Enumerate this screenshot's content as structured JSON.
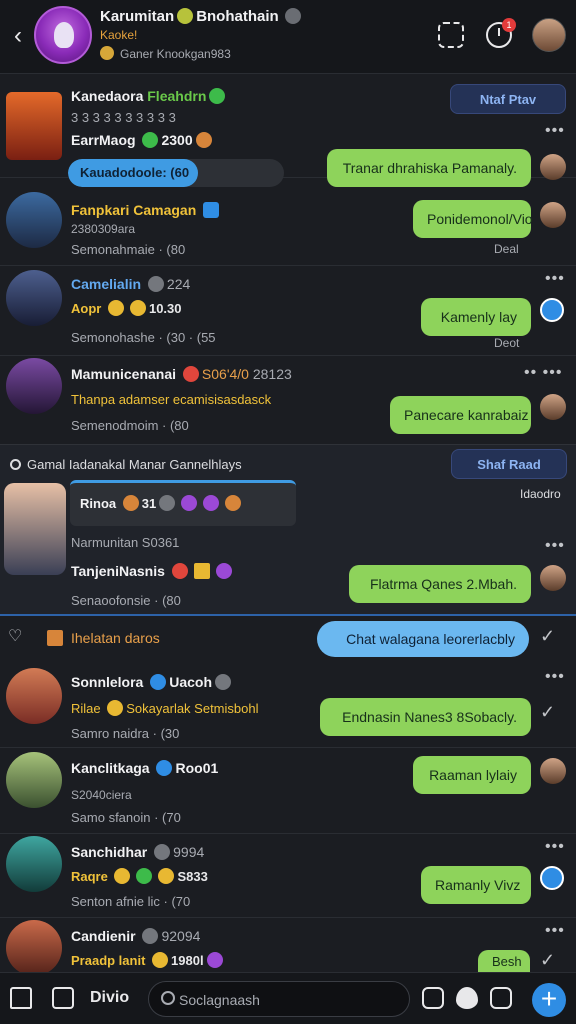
{
  "header": {
    "title": "Karumitan",
    "title_suffix": "Bnohathain",
    "sub1": "Kaoke!",
    "sub2": "Ganer Knookgan983"
  },
  "threads": [
    {
      "name": "Kanedaora",
      "status": "Fleahdrn",
      "meta_name": "EarrMaog",
      "meta_count": "2300",
      "progress_label": "Kauadodoole: (60",
      "progress_pct": 60,
      "action_label": "Ntaf Ptav",
      "bubble": "Tranar dhrahiska Pamanaly."
    },
    {
      "name": "Fanpkari Camagan",
      "sub": "2380309ara",
      "meta": "Semonahmaie · (80",
      "bubble": "Ponidemonol/Vio",
      "time": "Deal"
    },
    {
      "name": "Camelialin",
      "count": "224",
      "preview": "Aopr",
      "preview_count": "10.30",
      "meta": "Semonohashe · (30 · (55",
      "bubble": "Kamenly lay",
      "time": "Deot"
    },
    {
      "name": "Mamunicenanai",
      "extra": "S06'4/0",
      "count": "28123",
      "preview": "Thanpa adamser ecamisisasdasck",
      "meta": "Semenodmoim · (80",
      "bubble": "Panecare kanrabaiz"
    },
    {
      "banner_text": "Gamal Iadanakal Manar Gannelhlays",
      "banner_button": "Shaf Raad",
      "card_text": "Rinoa",
      "card_count": "31",
      "meta_name": "Narmunitan S0361",
      "time": "Idaodro",
      "name": "TanjeniNasnis",
      "bubble": "Flatrma Qanes 2.Mbah.",
      "meta": "Senaoofonsie · (80"
    },
    {
      "section_label": "Ihelatan daros",
      "bubble": "Chat walagana leorerlacbly"
    },
    {
      "name": "Sonnlelora",
      "tag": "Uacoh",
      "preview": "Rilae",
      "preview_rest": "Sokayarlak Setmisbohl",
      "meta": "Samro naidra · (30",
      "bubble": "Endnasin Nanes3 8Sobacly."
    },
    {
      "name": "Kanclitkaga",
      "tag": "Roo01",
      "sub": "S2040ciera",
      "meta": "Samo sfanoin · (70",
      "bubble": "Raaman lylaiy"
    },
    {
      "name": "Sanchidhar",
      "count": "9994",
      "preview": "Raqre",
      "preview_count": "S833",
      "meta": "Senton afnie lic · (70",
      "bubble": "Ramanly Vivz"
    },
    {
      "name": "Candienir",
      "count": "92094",
      "preview": "Praadp lanit",
      "preview_count": "1980l",
      "bubble": "Besh"
    }
  ],
  "bottom": {
    "tab_label": "Divio",
    "search_placeholder": "Soclagnaash"
  },
  "colors": {
    "bubble": "#8ed35b",
    "accent": "#2f8de4",
    "name_yellow": "#f0c23a"
  }
}
